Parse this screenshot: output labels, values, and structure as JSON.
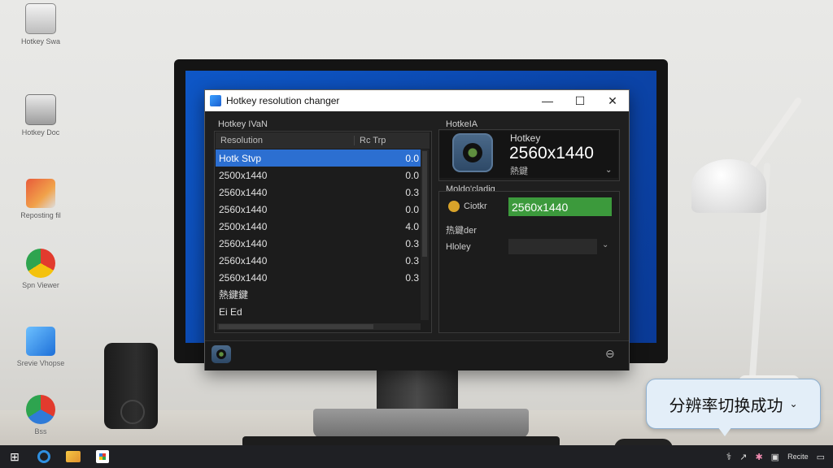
{
  "desktop": {
    "icons": [
      {
        "label": "Hotkey Swa"
      },
      {
        "label": "Hotkey Doc"
      },
      {
        "label": "Reposting fil"
      },
      {
        "label": "Spn Viewer"
      },
      {
        "label": "Srevie Vhopse"
      },
      {
        "label": "Bss"
      }
    ]
  },
  "window": {
    "title": "Hotkey resolution changer",
    "minimize": "—",
    "maximize": "☐",
    "close": "✕"
  },
  "left_panel": {
    "title": "Hotkey IVaN",
    "headers": [
      "Resolution",
      "Rc Trp"
    ],
    "rows": [
      {
        "name": "Hotk Stvp",
        "val": "0.0",
        "selected": true
      },
      {
        "name": "2500x1440",
        "val": "0.0"
      },
      {
        "name": "2560x1440",
        "val": "0.3"
      },
      {
        "name": "2560x1440",
        "val": "0.0"
      },
      {
        "name": "2500x1440",
        "val": "4.0"
      },
      {
        "name": "2560x1440",
        "val": "0.3"
      },
      {
        "name": "2560x1440",
        "val": "0.3"
      },
      {
        "name": "2560x1440",
        "val": "0.3"
      },
      {
        "name": "熱鍵鍵",
        "val": ""
      },
      {
        "name": "Ei Ed",
        "val": ""
      }
    ]
  },
  "hotkey_panel": {
    "title": "HotkeIA",
    "label": "Hotkey",
    "resolution": "2560x1440",
    "sublabel": "熱鍵",
    "dropdown": "⌄"
  },
  "settings_panel": {
    "title": "Moldo'cladig",
    "field1_label": "Ciotkr",
    "field1_value": "2560x1440",
    "section2": "热鍵der",
    "field2_label": "Hloley",
    "field2_dropdown": "⌄"
  },
  "footer": {
    "right_icon": "⊖"
  },
  "toast": {
    "message": "分辨率切换成功",
    "chevron": "⌄"
  },
  "taskbar": {
    "start": "⊞",
    "tray_label": "Recite"
  }
}
